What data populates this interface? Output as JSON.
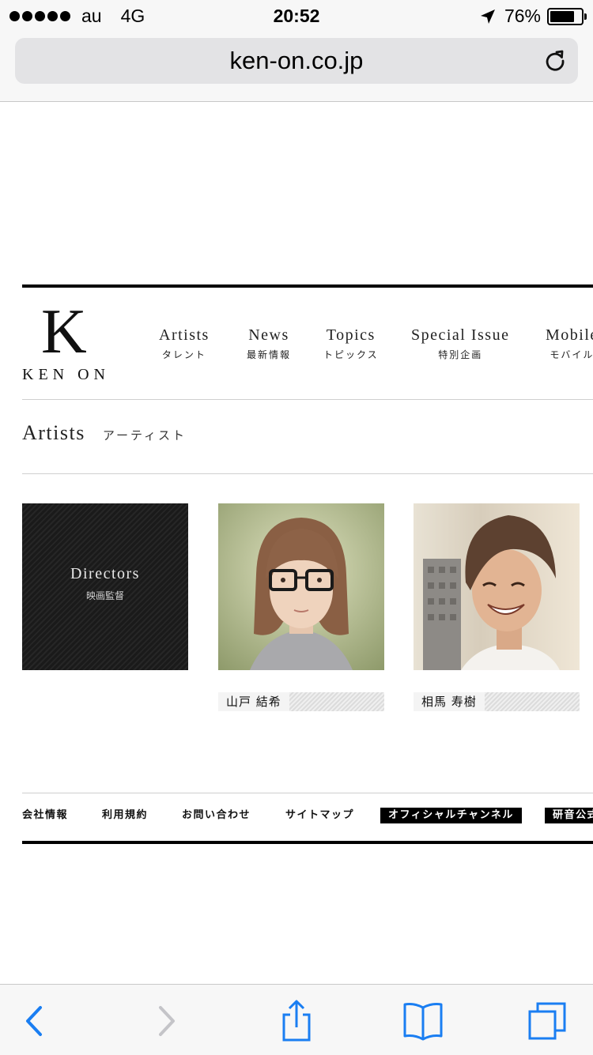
{
  "status_bar": {
    "carrier": "au",
    "network": "4G",
    "time": "20:52",
    "battery": "76%",
    "battery_level": 0.76,
    "signal_bars": 5,
    "icons": [
      "location-arrow-icon",
      "battery-icon"
    ]
  },
  "browser": {
    "url": "ken-on.co.jp",
    "reload_icon": "reload-icon",
    "accent": "#1a7ef2",
    "toolbar_icons": [
      "back-icon",
      "forward-icon",
      "share-icon",
      "bookmarks-icon",
      "tabs-icon"
    ]
  },
  "site": {
    "logo": {
      "letter": "K",
      "name": "KEN ON"
    },
    "nav": [
      {
        "en": "Artists",
        "jp": "タレント"
      },
      {
        "en": "News",
        "jp": "最新情報"
      },
      {
        "en": "Topics",
        "jp": "トピックス"
      },
      {
        "en": "Special Issue",
        "jp": "特別企画"
      },
      {
        "en": "Mobile",
        "jp": "モバイル"
      }
    ],
    "section": {
      "title_en": "Artists",
      "title_jp": "アーティスト"
    },
    "cards": {
      "directors": {
        "en": "Directors",
        "jp": "映画監督"
      },
      "artist1": {
        "name": "山戸 結希"
      },
      "artist2": {
        "name": "相馬 寿樹"
      }
    },
    "footer_links": [
      "会社情報",
      "利用規約",
      "お問い合わせ",
      "サイトマップ",
      "オフィシャルチャンネル",
      "研音公式"
    ]
  }
}
